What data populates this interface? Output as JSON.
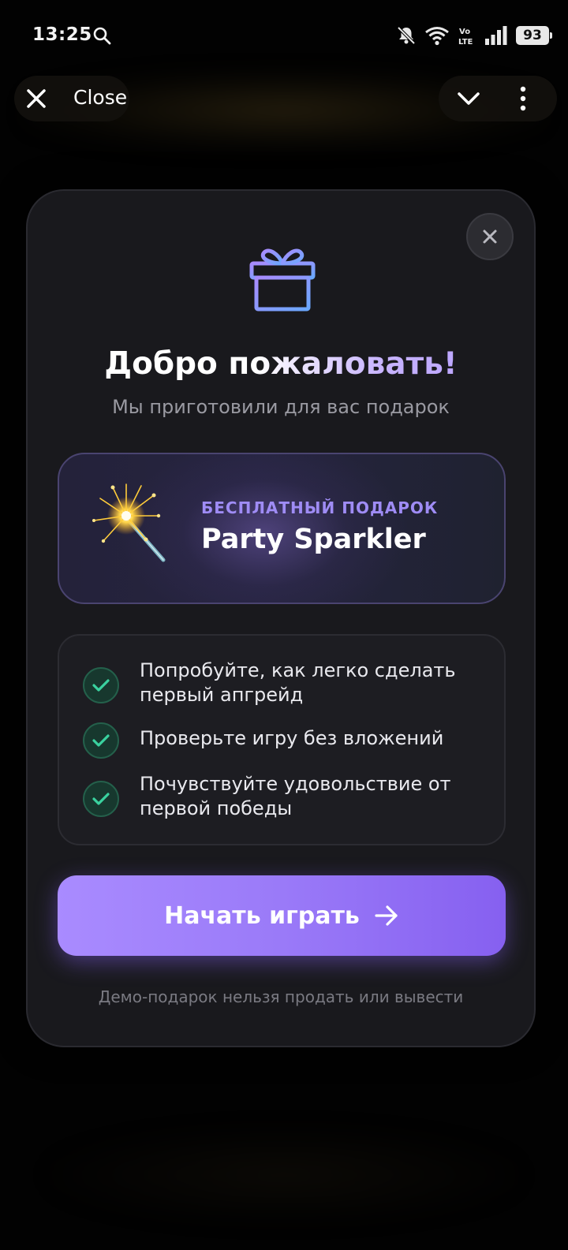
{
  "status_bar": {
    "time": "13:25",
    "battery": "93",
    "icons": [
      "search-icon",
      "mute-icon",
      "wifi-icon",
      "volte-icon",
      "signal-icon",
      "battery-icon"
    ]
  },
  "app_bar": {
    "close_label": "Close",
    "icons": [
      "close-icon",
      "chevron-down-icon",
      "more-vertical-icon"
    ]
  },
  "modal": {
    "icon": "gift-icon",
    "title": "Добро пожаловать!",
    "subtitle": "Мы приготовили для вас подарок",
    "gift_card": {
      "label": "БЕСПЛАТНЫЙ ПОДАРОК",
      "name": "Party Sparkler",
      "icon": "sparkler-icon"
    },
    "benefits": [
      {
        "text": "Попробуйте, как легко сделать первый апгрейд"
      },
      {
        "text": "Проверьте игру без вложений"
      },
      {
        "text": "Почувствуйте удовольствие от первой победы"
      }
    ],
    "cta_label": "Начать играть",
    "disclaimer": "Демо-подарок нельзя продать или вывести"
  },
  "colors": {
    "accent": "#9a7af8",
    "success": "#3ad29f",
    "modal_bg": "#19191d"
  }
}
